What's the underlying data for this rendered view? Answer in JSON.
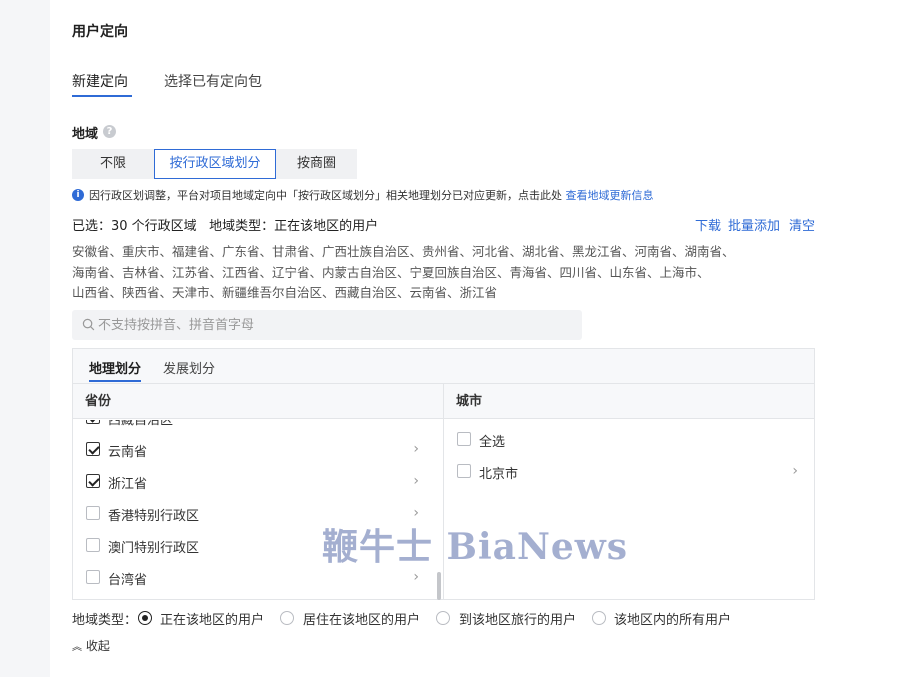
{
  "section_title": "用户定向",
  "tabs": [
    {
      "label": "新建定向",
      "active": true
    },
    {
      "label": "选择已有定向包",
      "active": false
    }
  ],
  "region": {
    "label": "地域",
    "help_icon": "question-circle-icon",
    "modes": [
      {
        "label": "不限",
        "active": false
      },
      {
        "label": "按行政区域划分",
        "active": true
      },
      {
        "label": "按商圈",
        "active": false
      }
    ],
    "notice": {
      "icon": "info-icon",
      "text": "因行政区划调整，平台对项目地域定向中「按行政区域划分」相关地理划分已对应更新，点击此处",
      "link": "查看地域更新信息"
    },
    "selected_summary": "已选：30 个行政区域   地域类型：正在该地区的用户",
    "actions": {
      "download": "下载",
      "batch_add": "批量添加",
      "clear": "清空"
    },
    "selected_lines": [
      "安徽省、重庆市、福建省、广东省、甘肃省、广西壮族自治区、贵州省、河北省、湖北省、黑龙江省、河南省、湖南省、",
      "海南省、吉林省、江苏省、江西省、辽宁省、内蒙古自治区、宁夏回族自治区、青海省、四川省、山东省、上海市、",
      "山西省、陕西省、天津市、新疆维吾尔自治区、西藏自治区、云南省、浙江省"
    ],
    "search": {
      "placeholder": "不支持按拼音、拼音首字母",
      "value": ""
    },
    "tree": {
      "tabs": [
        {
          "label": "地理划分",
          "active": true
        },
        {
          "label": "发展划分",
          "active": false
        }
      ],
      "province_header": "省份",
      "city_header": "城市",
      "provinces": [
        {
          "label": "西藏自治区",
          "checked": true,
          "has_children": true
        },
        {
          "label": "云南省",
          "checked": true,
          "has_children": true
        },
        {
          "label": "浙江省",
          "checked": true,
          "has_children": true
        },
        {
          "label": "香港特别行政区",
          "checked": false,
          "has_children": true
        },
        {
          "label": "澳门特别行政区",
          "checked": false,
          "has_children": false
        },
        {
          "label": "台湾省",
          "checked": false,
          "has_children": true
        }
      ],
      "cities": [
        {
          "label": "全选",
          "checked": false,
          "has_children": false
        },
        {
          "label": "北京市",
          "checked": false,
          "has_children": true
        }
      ]
    },
    "region_type": {
      "label": "地域类型：",
      "options": [
        {
          "label": "正在该地区的用户",
          "checked": true
        },
        {
          "label": "居住在该地区的用户",
          "checked": false
        },
        {
          "label": "到该地区旅行的用户",
          "checked": false
        },
        {
          "label": "该地区内的所有用户",
          "checked": false
        }
      ]
    },
    "collapse_label": "收起",
    "collapse_icon": "chevron-up-double-icon"
  },
  "watermark": "鞭牛士 BiaNews",
  "colors": {
    "accent": "#2f6bd6",
    "background": "#f5f6f8"
  }
}
